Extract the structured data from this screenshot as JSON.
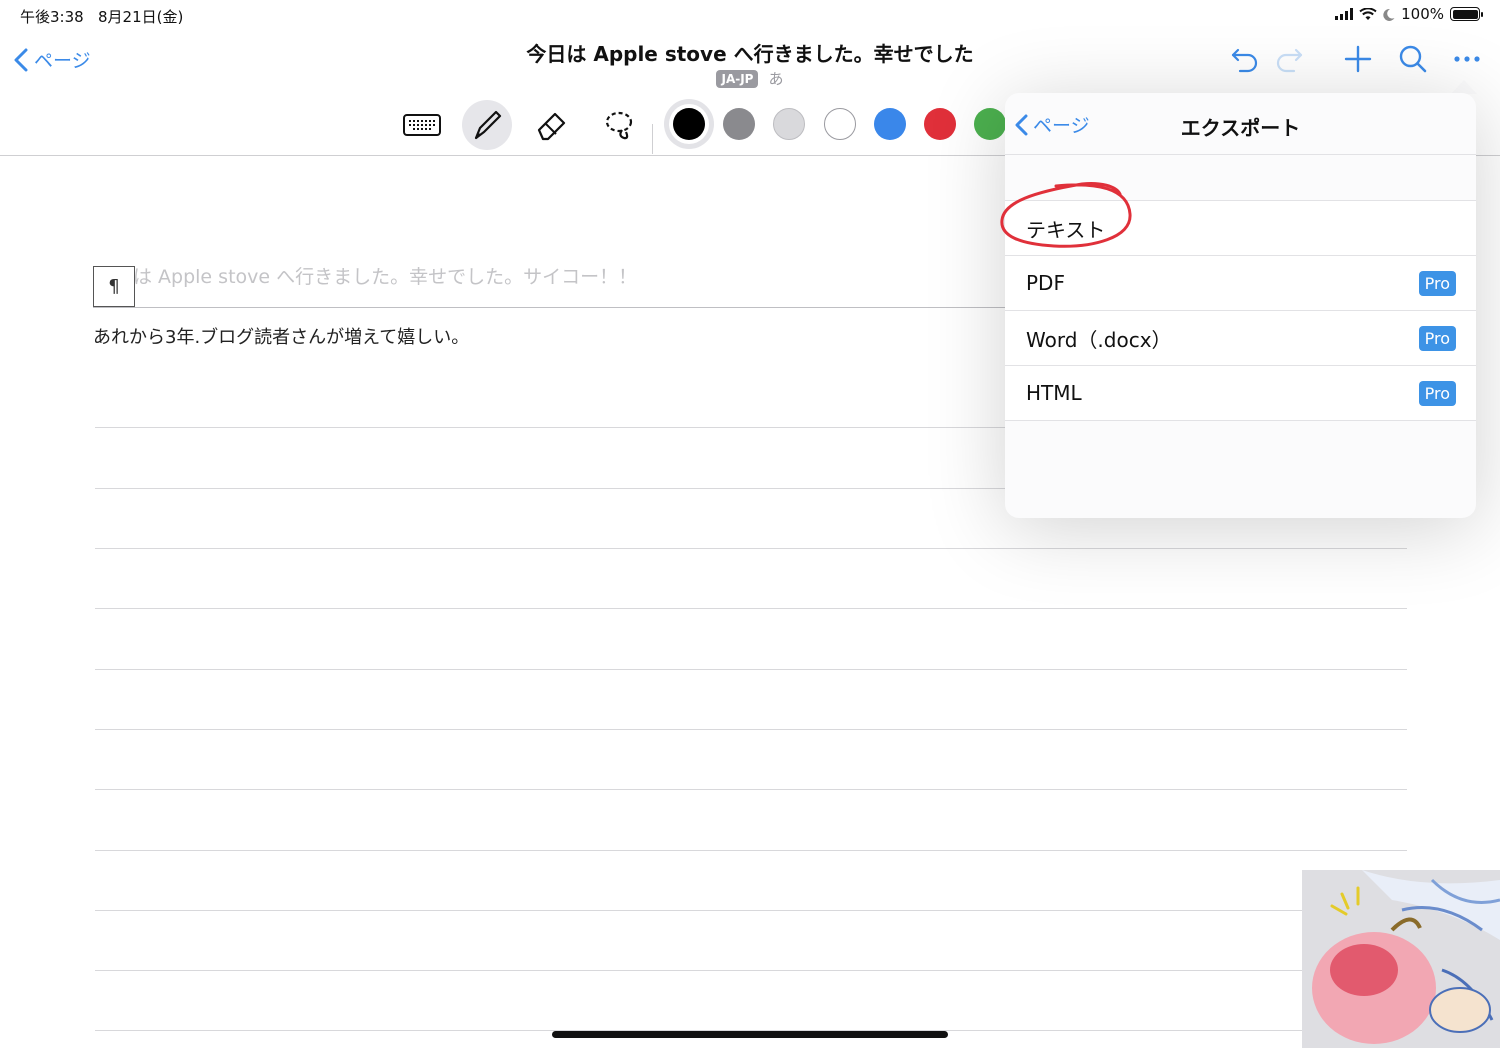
{
  "status": {
    "time": "午後3:38",
    "date": "8月21日(金)",
    "battery": "100%"
  },
  "nav": {
    "back_label": "ページ",
    "title": "今日は Apple stove へ行きました。幸せでした",
    "lang_badge": "JA-JP",
    "kana": "あ"
  },
  "toolbar": {
    "tools": [
      "keyboard-icon",
      "pen-icon",
      "eraser-icon",
      "lasso-icon"
    ],
    "colors": [
      "#000000",
      "#8a8a8e",
      "#d9d9dc",
      "#ffffff",
      "#3a87ea",
      "#e0303a",
      "#4cb04f"
    ]
  },
  "page": {
    "para_mark": "¶",
    "faded_line": "は Apple stove へ行きました。幸せでした。サイコー！！",
    "body_line": "あれから3年.ブログ読者さんが増えて嬉しい。"
  },
  "popover": {
    "back_label": "ページ",
    "title": "エクスポート",
    "items": [
      {
        "label": "テキスト",
        "badge": ""
      },
      {
        "label": "PDF",
        "badge": "Pro"
      },
      {
        "label": "Word（.docx）",
        "badge": "Pro"
      },
      {
        "label": "HTML",
        "badge": "Pro"
      }
    ]
  },
  "colors": {
    "accent": "#3b8ae8",
    "pro_badge": "#3d93e6",
    "annotation": "#e0303a"
  }
}
